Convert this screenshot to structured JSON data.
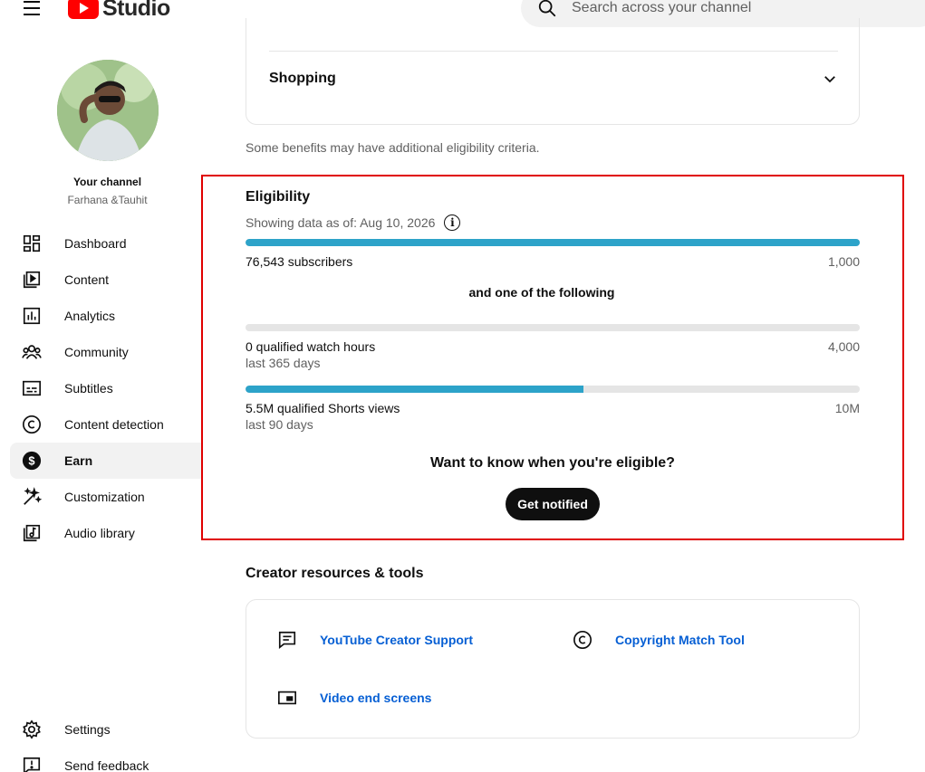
{
  "header": {
    "logo_text": "Studio",
    "search_placeholder": "Search across your channel"
  },
  "sidebar": {
    "your_channel": "Your channel",
    "channel_name": "Farhana &Tauhit",
    "items": [
      {
        "label": "Dashboard",
        "icon": "dashboard-icon"
      },
      {
        "label": "Content",
        "icon": "content-icon"
      },
      {
        "label": "Analytics",
        "icon": "analytics-icon"
      },
      {
        "label": "Community",
        "icon": "community-icon"
      },
      {
        "label": "Subtitles",
        "icon": "subtitles-icon"
      },
      {
        "label": "Content detection",
        "icon": "copyright-icon"
      },
      {
        "label": "Earn",
        "icon": "dollar-icon",
        "active": true
      },
      {
        "label": "Customization",
        "icon": "magic-wand-icon"
      },
      {
        "label": "Audio library",
        "icon": "audio-library-icon"
      }
    ],
    "bottom_items": [
      {
        "label": "Settings",
        "icon": "gear-icon"
      },
      {
        "label": "Send feedback",
        "icon": "feedback-icon"
      }
    ]
  },
  "main": {
    "shopping_title": "Shopping",
    "benefits_note": "Some benefits may have additional eligibility criteria.",
    "eligibility": {
      "title": "Eligibility",
      "date_text": "Showing data as of: Aug 10, 2026",
      "info_glyph": "i",
      "subscribers": {
        "label": "76,543 subscribers",
        "target": "1,000",
        "progress": 1.0
      },
      "one_of": "and one of the following",
      "watch_hours": {
        "label": "0 qualified watch hours",
        "target": "4,000",
        "period": "last 365 days",
        "progress": 0.0
      },
      "shorts_views": {
        "label": "5.5M qualified Shorts views",
        "target": "10M",
        "period": "last 90 days",
        "progress": 0.55
      },
      "want_text": "Want to know when you're eligible?",
      "button_label": "Get notified"
    },
    "tools": {
      "title": "Creator resources & tools",
      "items": [
        {
          "label": "YouTube Creator Support",
          "icon": "feedback-chat-icon"
        },
        {
          "label": "Copyright Match Tool",
          "icon": "copyright-icon"
        },
        {
          "label": "Video end screens",
          "icon": "end-screen-icon"
        }
      ]
    }
  },
  "colors": {
    "accent_progress": "#2da3c9",
    "highlight_border": "#e00000",
    "link": "#065fd4",
    "brand_red": "#ff0000"
  }
}
